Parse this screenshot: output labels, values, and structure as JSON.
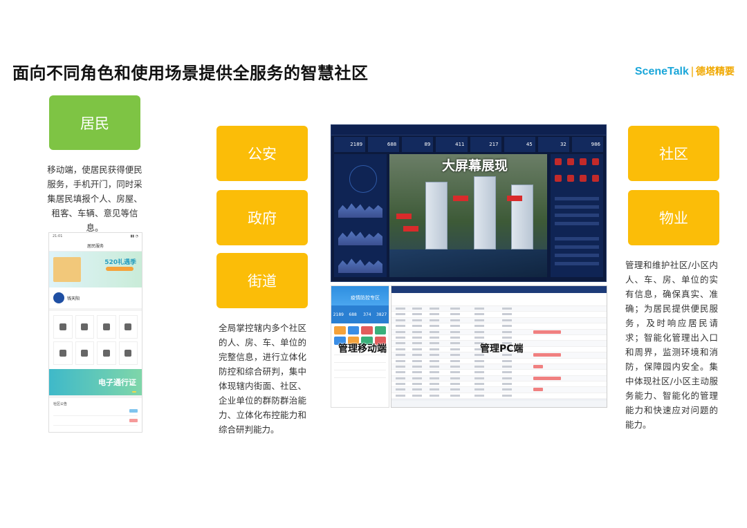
{
  "header": {
    "title": "面向不同角色和使用场景提供全服务的智慧社区",
    "brand_latin": "SceneTalk",
    "brand_sep": "|",
    "brand_cn": "德塔精要"
  },
  "roles": {
    "resident": "居民",
    "police": "公安",
    "government": "政府",
    "street": "街道",
    "community": "社区",
    "property": "物业"
  },
  "descriptions": {
    "resident": "移动端，使居民获得便民服务，手机开门，同时采集居民填报个人、房屋、租客、车辆、意见等信息。",
    "government": "全局掌控辖内多个社区的人、房、车、单位的完整信息，进行立体化防控和综合研判，集中体现辖内街面、社区、企业单位的群防群治能力、立体化布控能力和综合研判能力。",
    "property": "管理和维护社区/小区内人、车、房、单位的实有信息，确保真实、准确；为居民提供便民服务，及时响应居民请求；智能化管理出入口和周界，监测环境和消防，保障园内安全。集中体现社区/小区主动服务能力、智能化的管理能力和快速应对问题的能力。"
  },
  "phone": {
    "time": "21:01",
    "header": "居民服务",
    "banner": "520礼遇季",
    "user": "钱天阳",
    "pass": "电子通行证",
    "notice": "社区公告"
  },
  "screens": {
    "big_caption": "大屏幕展现",
    "stats": [
      "2189",
      "688",
      "89",
      "411",
      "217",
      "45",
      "32",
      "986"
    ],
    "mobile_caption": "管理移动端",
    "mobile_title": "疫情防控专区",
    "mobile_stats": [
      "2189",
      "688",
      "374",
      "3827"
    ],
    "pc_caption": "管理PC端"
  }
}
